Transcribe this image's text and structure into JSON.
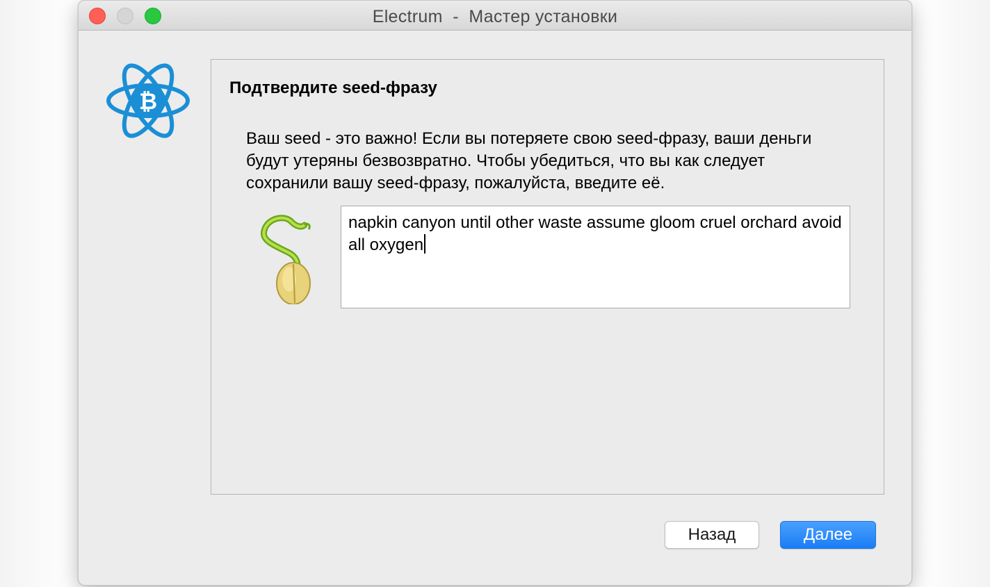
{
  "window": {
    "title": "Electrum  -  Мастер установки"
  },
  "wizard": {
    "heading": "Подтвердите seed-фразу",
    "message": "Ваш seed - это важно! Если вы потеряете свою seed-фразу, ваши деньги будут утеряны безвозвратно. Чтобы убедиться, что вы как следует сохранили вашу seed-фразу, пожалуйста, введите её.",
    "seed_value": "napkin canyon until other waste assume gloom cruel orchard avoid all oxygen"
  },
  "buttons": {
    "back_label": "Назад",
    "next_label": "Далее"
  },
  "colors": {
    "logo_blue": "#1a8fd6",
    "primary_button": "#1a7df5",
    "close": "#fe5f57",
    "maximize": "#28c840"
  },
  "icons": {
    "logo": "electrum-logo-icon",
    "seed": "seed-sprout-icon"
  }
}
